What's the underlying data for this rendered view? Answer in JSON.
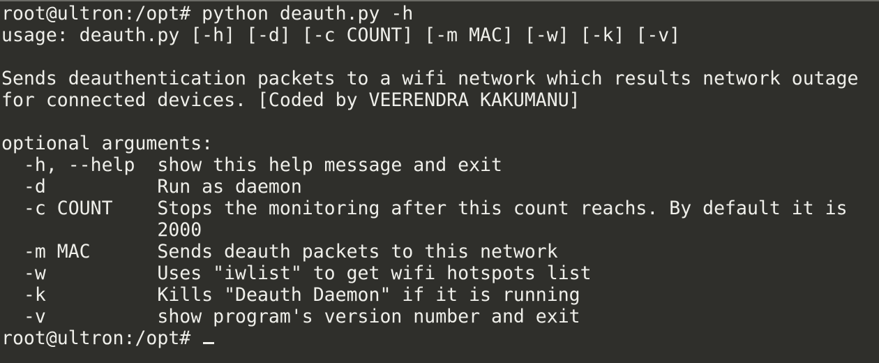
{
  "terminal": {
    "lines": [
      {
        "text": "root@ultron:/opt# python deauth.py -h",
        "kind": "prompt"
      },
      {
        "text": "usage: deauth.py [-h] [-d] [-c COUNT] [-m MAC] [-w] [-k] [-v]",
        "kind": "output"
      },
      {
        "text": "",
        "kind": "blank"
      },
      {
        "text": "Sends deauthentication packets to a wifi network which results network outage",
        "kind": "output"
      },
      {
        "text": "for connected devices. [Coded by VEERENDRA KAKUMANU]",
        "kind": "output"
      },
      {
        "text": "",
        "kind": "blank"
      },
      {
        "text": "optional arguments:",
        "kind": "output"
      },
      {
        "text": "  -h, --help  show this help message and exit",
        "kind": "output"
      },
      {
        "text": "  -d          Run as daemon",
        "kind": "output"
      },
      {
        "text": "  -c COUNT    Stops the monitoring after this count reachs. By default it is",
        "kind": "output"
      },
      {
        "text": "              2000",
        "kind": "output"
      },
      {
        "text": "  -m MAC      Sends deauth packets to this network",
        "kind": "output"
      },
      {
        "text": "  -w          Uses \"iwlist\" to get wifi hotspots list",
        "kind": "output"
      },
      {
        "text": "  -k          Kills \"Deauth Daemon\" if it is running",
        "kind": "output"
      },
      {
        "text": "  -v          show program's version number and exit",
        "kind": "output"
      }
    ],
    "final_prompt": "root@ultron:/opt# ",
    "colors": {
      "background": "#2f2f2b",
      "foreground": "#efefea"
    }
  }
}
